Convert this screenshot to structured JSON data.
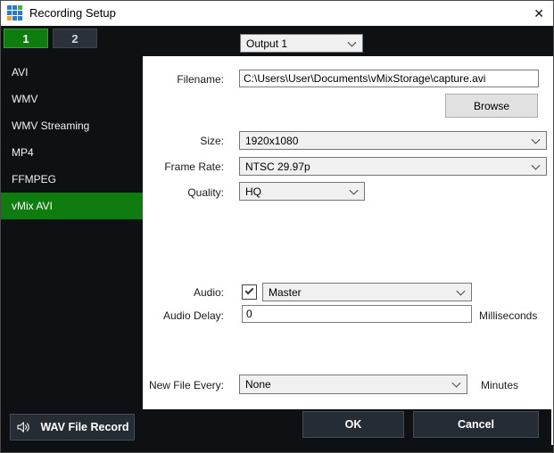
{
  "window": {
    "title": "Recording Setup",
    "close_glyph": "✕"
  },
  "tabs": [
    {
      "label": "1",
      "selected": true
    },
    {
      "label": "2",
      "selected": false
    }
  ],
  "output_select": {
    "value": "Output 1"
  },
  "sidebar": {
    "items": [
      {
        "label": "AVI",
        "selected": false
      },
      {
        "label": "WMV",
        "selected": false
      },
      {
        "label": "WMV Streaming",
        "selected": false
      },
      {
        "label": "MP4",
        "selected": false
      },
      {
        "label": "FFMPEG",
        "selected": false
      },
      {
        "label": "vMix AVI",
        "selected": true
      }
    ]
  },
  "form": {
    "filename": {
      "label": "Filename:",
      "value": "C:\\Users\\User\\Documents\\vMixStorage\\capture.avi"
    },
    "browse_label": "Browse",
    "size": {
      "label": "Size:",
      "value": "1920x1080"
    },
    "frame_rate": {
      "label": "Frame Rate:",
      "value": "NTSC 29.97p"
    },
    "quality": {
      "label": "Quality:",
      "value": "HQ"
    },
    "audio": {
      "label": "Audio:",
      "checked": true,
      "value": "Master"
    },
    "audio_delay": {
      "label": "Audio Delay:",
      "value": "0",
      "unit": "Milliseconds"
    },
    "new_file_every": {
      "label": "New File Every:",
      "value": "None",
      "unit": "Minutes"
    }
  },
  "footer": {
    "wav_label": "WAV File Record",
    "ok_label": "OK",
    "cancel_label": "Cancel"
  },
  "colors": {
    "accent_green": "#0e7c0e",
    "accent_green_border": "#2fa32f",
    "dark_bg": "#0e1114",
    "panel_bg": "#ffffff",
    "dark_button": "#262c33",
    "icon_blue": "#2f7ac5",
    "icon_green": "#55a946",
    "icon_orange": "#f0a32f"
  }
}
